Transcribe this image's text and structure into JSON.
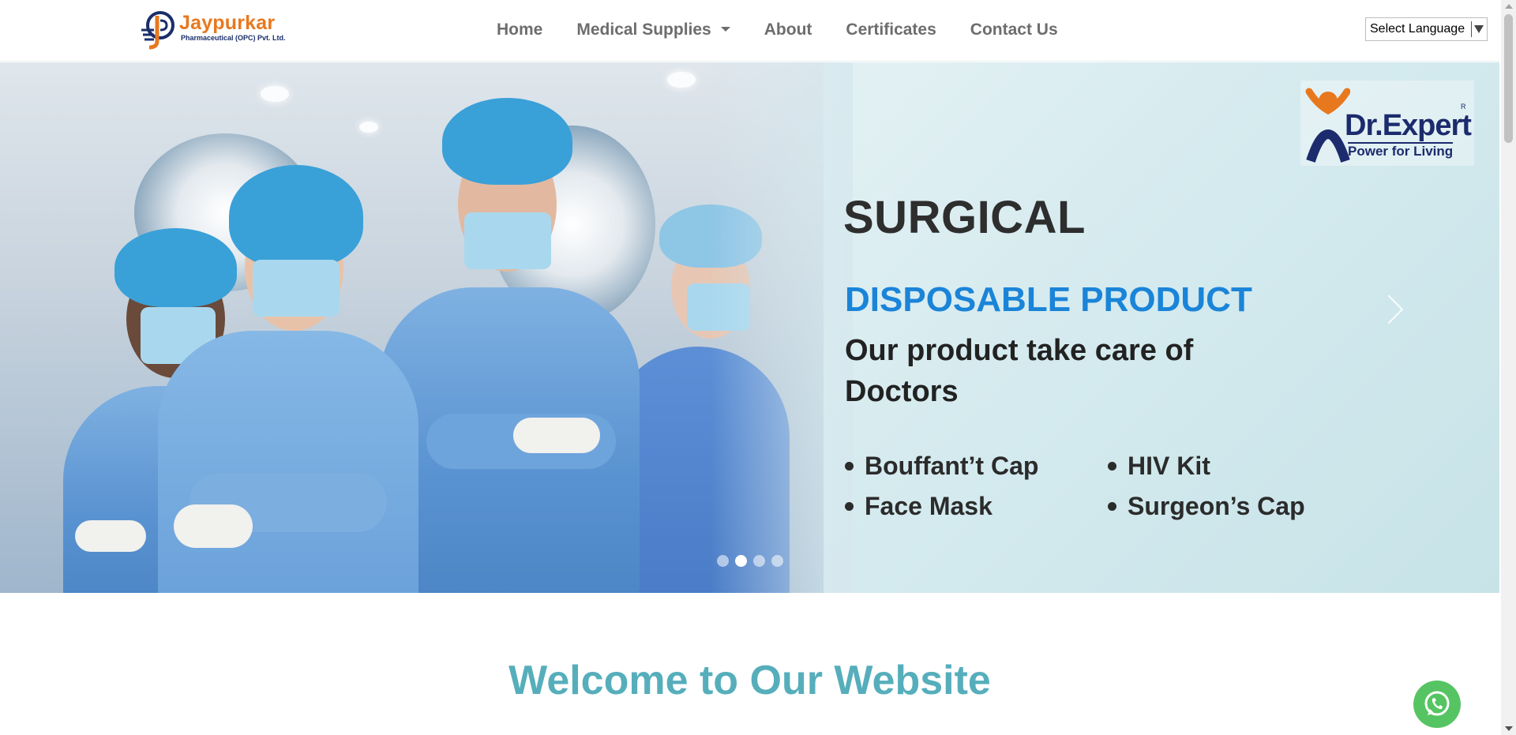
{
  "header": {
    "logo": {
      "name": "Jaypurkar",
      "sub": "Pharmaceutical (OPC) Pvt. Ltd."
    },
    "nav": [
      {
        "label": "Home"
      },
      {
        "label": "Medical Supplies",
        "dropdown": true
      },
      {
        "label": "About"
      },
      {
        "label": "Certificates"
      },
      {
        "label": "Contact Us"
      }
    ],
    "language_select": {
      "value": "Select Language"
    }
  },
  "hero": {
    "brand": {
      "name": "Dr.Expert",
      "tagline": "Power for Living",
      "reg": "R"
    },
    "title": "SURGICAL",
    "subtitle": "DISPOSABLE PRODUCT",
    "tagline": "Our product take care of Doctors",
    "bullets": [
      "Bouffant’t Cap",
      "HIV Kit",
      "Face Mask",
      "Surgeon’s Cap"
    ],
    "slides": {
      "count": 4,
      "active_index": 1
    }
  },
  "main": {
    "welcome_heading": "Welcome to Our Website"
  },
  "colors": {
    "accent": "#e8781e",
    "navy": "#1a2e6b",
    "heading": "#56aebb",
    "blue": "#1a84d8",
    "whatsapp": "#56c463"
  },
  "icons": {
    "whatsapp": "whatsapp-icon",
    "next": "chevron-right-icon"
  }
}
